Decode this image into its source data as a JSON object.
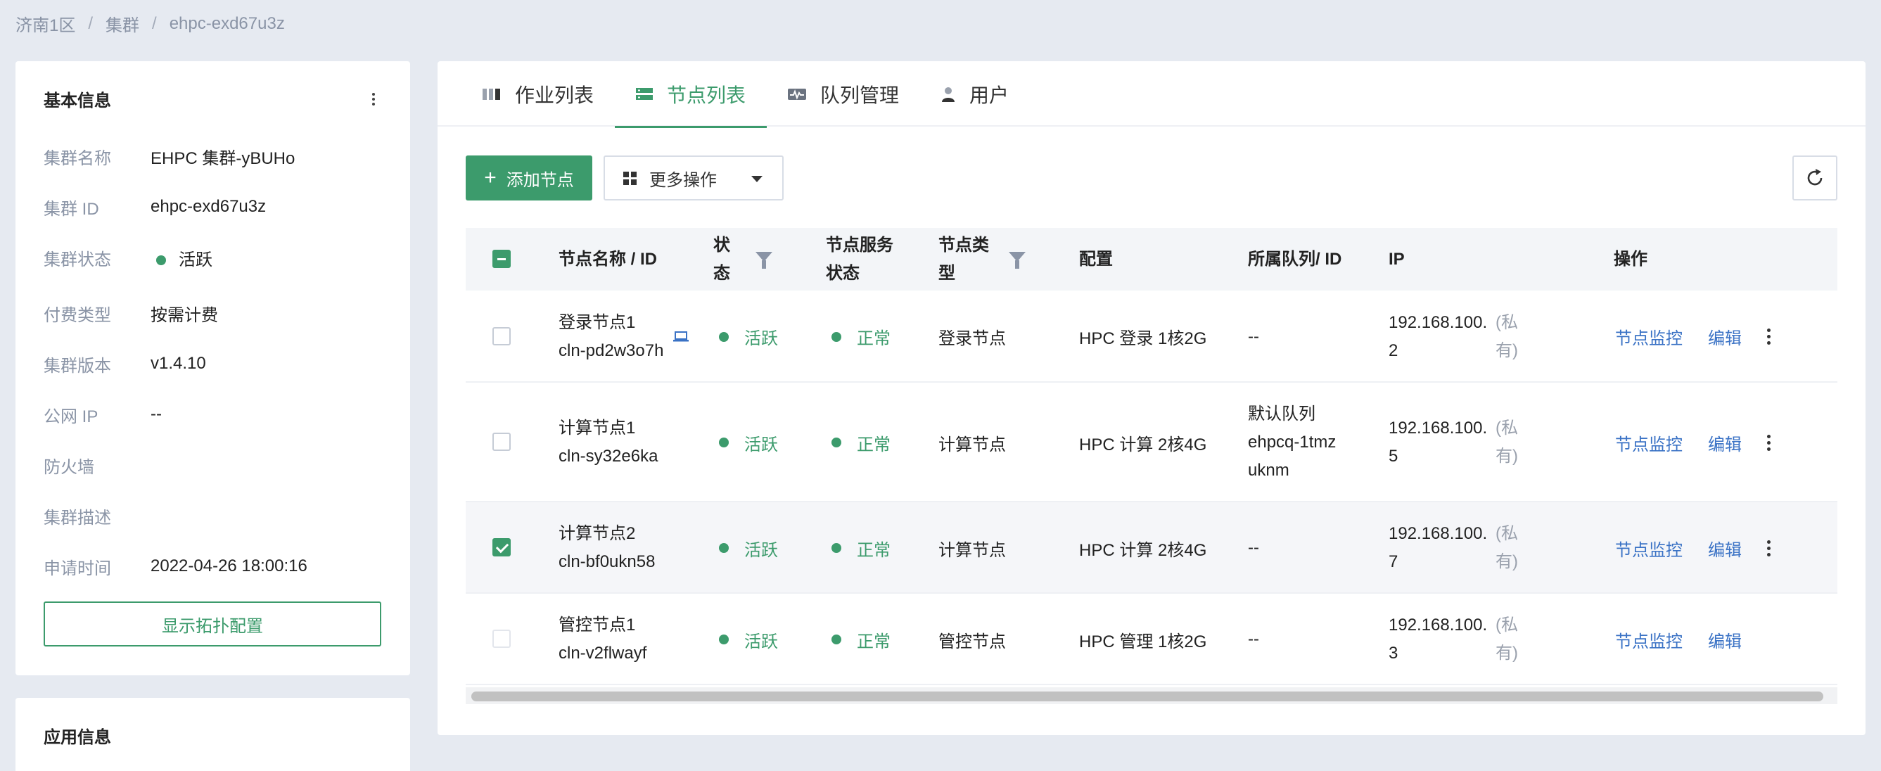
{
  "breadcrumb": [
    "济南1区",
    "集群",
    "ehpc-exd67u3z"
  ],
  "basic_info": {
    "title": "基本信息",
    "rows": [
      {
        "label": "集群名称",
        "value": "EHPC 集群-yBUHo"
      },
      {
        "label": "集群 ID",
        "value": "ehpc-exd67u3z"
      },
      {
        "label": "集群状态",
        "value": "活跃"
      },
      {
        "label": "付费类型",
        "value": "按需计费"
      },
      {
        "label": "集群版本",
        "value": "v1.4.10"
      },
      {
        "label": "公网 IP",
        "value": "--"
      },
      {
        "label": "防火墙",
        "value": ""
      },
      {
        "label": "集群描述",
        "value": ""
      },
      {
        "label": "申请时间",
        "value": "2022-04-26 18:00:16"
      }
    ],
    "topology_button": "显示拓扑配置"
  },
  "app_info": {
    "title": "应用信息"
  },
  "tabs": [
    {
      "label": "作业列表",
      "icon": "job-list-icon"
    },
    {
      "label": "节点列表",
      "icon": "node-list-icon",
      "active": true
    },
    {
      "label": "队列管理",
      "icon": "queue-icon"
    },
    {
      "label": "用户",
      "icon": "user-icon"
    }
  ],
  "toolbar": {
    "add_label": "添加节点",
    "more_label": "更多操作"
  },
  "table": {
    "headers": {
      "name": "节点名称 / ID",
      "status_1": "状",
      "status_2": "态",
      "service_1": "节点服务",
      "service_2": "状态",
      "type_1": "节点类",
      "type_2": "型",
      "config": "配置",
      "queue": "所属队列/ ID",
      "ip": "IP",
      "action": "操作"
    },
    "rows": [
      {
        "name": "登录节点1",
        "id": "cln-pd2w3o7h",
        "status": "活跃",
        "service": "正常",
        "type": "登录节点",
        "config": "HPC 登录 1核2G",
        "queue": [
          "--"
        ],
        "ip_1": "192.168.100.",
        "ip_2": "2",
        "ip_tag_1": "(私",
        "ip_tag_2": "有)",
        "monitor": "节点监控",
        "edit": "编辑"
      },
      {
        "name": "计算节点1",
        "id": "cln-sy32e6ka",
        "status": "活跃",
        "service": "正常",
        "type": "计算节点",
        "config": "HPC 计算 2核4G",
        "queue": [
          "默认队列",
          "ehpcq-1tmz",
          "uknm"
        ],
        "ip_1": "192.168.100.",
        "ip_2": "5",
        "ip_tag_1": "(私",
        "ip_tag_2": "有)",
        "monitor": "节点监控",
        "edit": "编辑"
      },
      {
        "name": "计算节点2",
        "id": "cln-bf0ukn58",
        "status": "活跃",
        "service": "正常",
        "type": "计算节点",
        "config": "HPC 计算 2核4G",
        "queue": [
          "--"
        ],
        "ip_1": "192.168.100.",
        "ip_2": "7",
        "ip_tag_1": "(私",
        "ip_tag_2": "有)",
        "monitor": "节点监控",
        "edit": "编辑"
      },
      {
        "name": "管控节点1",
        "id": "cln-v2flwayf",
        "status": "活跃",
        "service": "正常",
        "type": "管控节点",
        "config": "HPC 管理 1核2G",
        "queue": [
          "--"
        ],
        "ip_1": "192.168.100.",
        "ip_2": "3",
        "ip_tag_1": "(私",
        "ip_tag_2": "有)",
        "monitor": "节点监控",
        "edit": "编辑"
      }
    ]
  },
  "colors": {
    "accent": "#3c9b6c",
    "link": "#3a72c5",
    "background": "#e6eaf1"
  }
}
